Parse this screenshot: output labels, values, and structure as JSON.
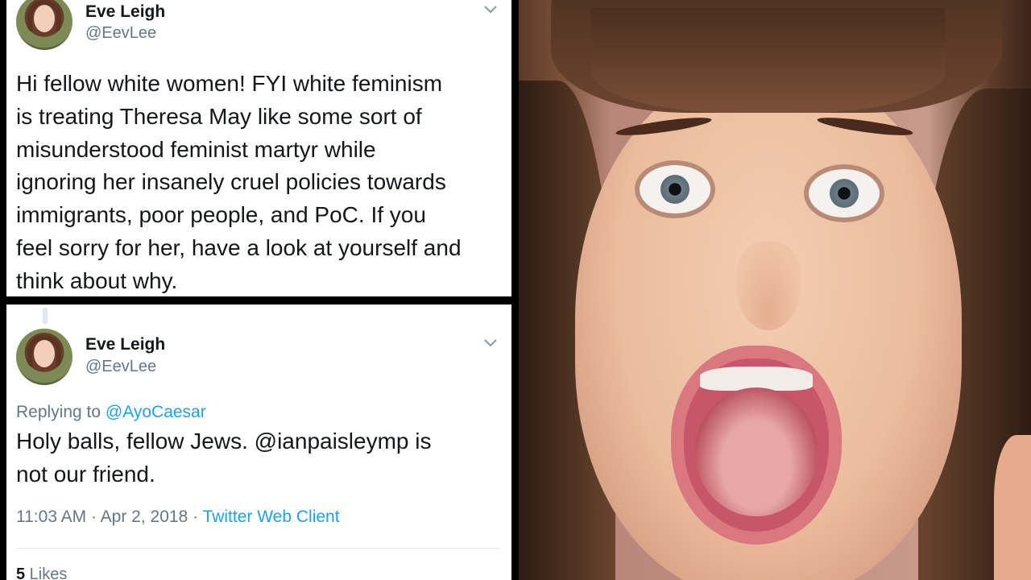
{
  "tweet_top": {
    "name": "Eve Leigh",
    "handle": "@EevLee",
    "text": "Hi fellow white women! FYI white feminism\nis treating Theresa May like some sort of\nmisunderstood feminist martyr while\nignoring her insanely cruel policies towards\nimmigrants, poor people, and PoC. If you\nfeel sorry for her, have a look at yourself and\nthink about why."
  },
  "tweet_bottom": {
    "name": "Eve Leigh",
    "handle": "@EevLee",
    "replying_prefix": "Replying to ",
    "replying_to": "@AyoCaesar",
    "text": "Holy balls, fellow Jews. @ianpaisleymp is\nnot our friend.",
    "time": "11:03 AM · Apr 2, 2018 · ",
    "client": "Twitter Web Client",
    "likes_count": "5",
    "likes_label": " Likes"
  },
  "icons": [
    "avatar",
    "chevron-down-icon"
  ],
  "colors": {
    "link": "#1da1f2",
    "muted": "#657786",
    "text": "#14171a",
    "divider": "#e1e8ed"
  }
}
